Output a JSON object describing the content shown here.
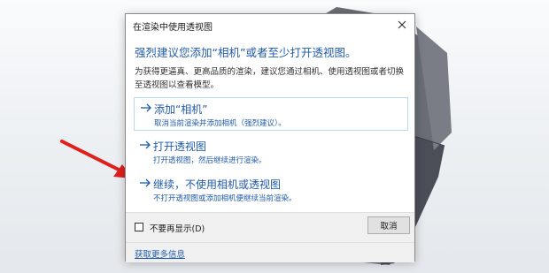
{
  "dialog": {
    "title": "在渲染中使用透视图",
    "main_instruction": "强烈建议您添加“相机”或者至少打开透视图。",
    "content": "为获得更逼真、更高品质的渲染，建议您通过相机、使用透视图或者切换至透视图以查看模型。",
    "commands": [
      {
        "arrow": "→",
        "title": "添加“相机”",
        "note": "取消当前渲染并添加相机（强烈建议）。"
      },
      {
        "arrow": "→",
        "title": "打开透视图",
        "note": "打开透视图，然后继续进行渲染。"
      },
      {
        "arrow": "→",
        "title": "继续，不使用相机或透视图",
        "note": "不打开透视图或添加相机便继续当前渲染。"
      }
    ],
    "checkbox_label": "不要再显示(D)",
    "checkbox_checked": false,
    "cancel_label": "取消",
    "more_info_link": "获取更多信息"
  },
  "icons": {
    "close": "close-icon",
    "command_arrow": "right-arrow-icon",
    "annotation_arrow": "red-pointer-arrow"
  },
  "colors": {
    "link_blue": "#1f5aa8",
    "annotation_red": "#e0201c",
    "model_gray": "#5a5d66"
  }
}
